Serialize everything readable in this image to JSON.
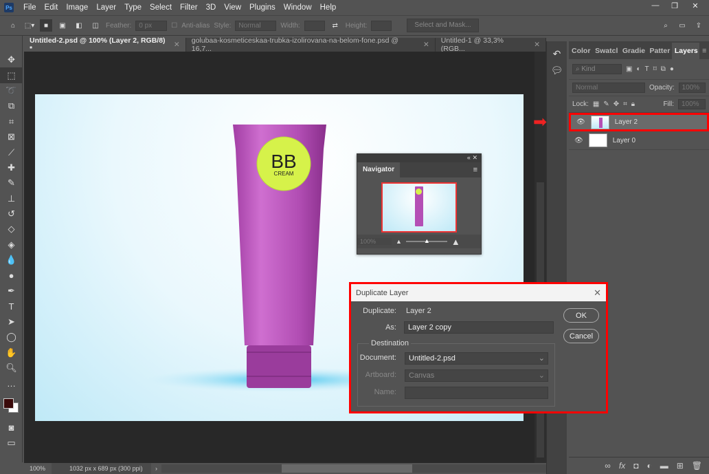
{
  "app": {
    "logo": "Ps",
    "menu": [
      "File",
      "Edit",
      "Image",
      "Layer",
      "Type",
      "Select",
      "Filter",
      "3D",
      "View",
      "Plugins",
      "Window",
      "Help"
    ]
  },
  "options": {
    "feather_label": "Feather:",
    "feather_value": "0 px",
    "antialias_label": "Anti-alias",
    "style_label": "Style:",
    "style_value": "Normal",
    "width_label": "Width:",
    "height_label": "Height:",
    "select_mask": "Select and Mask..."
  },
  "tabs": [
    {
      "label": "Untitled-2.psd @ 100% (Layer 2, RGB/8) *"
    },
    {
      "label": "golubaa-kosmeticeskaa-trubka-izolirovana-na-belom-fone.psd @ 16,7..."
    },
    {
      "label": "Untitled-1 @ 33,3% (RGB..."
    }
  ],
  "canvas": {
    "label_big": "BB",
    "label_small": "CREAM",
    "colors": {
      "tube": "#b44fb5",
      "badge": "#d6f24a"
    }
  },
  "status": {
    "zoom": "100%",
    "doc_info": "1032 px x 689 px (300 ppi)"
  },
  "navigator": {
    "title": "Navigator",
    "zoom": "100%",
    "slider_fraction": 0.5
  },
  "layers_panel": {
    "tabs": [
      "Color",
      "Swatcl",
      "Gradie",
      "Patter",
      "Layers"
    ],
    "kind": "Kind",
    "blend": "Normal",
    "opacity_label": "Opacity:",
    "opacity": "100%",
    "lock_label": "Lock:",
    "fill_label": "Fill:",
    "fill": "100%",
    "layers": [
      {
        "name": "Layer 2",
        "selected": true
      },
      {
        "name": "Layer 0",
        "selected": false
      }
    ]
  },
  "dialog": {
    "title": "Duplicate Layer",
    "duplicate_label": "Duplicate:",
    "duplicate_value": "Layer 2",
    "as_label": "As:",
    "as_value": "Layer 2 copy",
    "destination": "Destination",
    "document_label": "Document:",
    "document_value": "Untitled-2.psd",
    "artboard_label": "Artboard:",
    "artboard_value": "Canvas",
    "name_label": "Name:",
    "name_value": "",
    "ok": "OK",
    "cancel": "Cancel"
  }
}
